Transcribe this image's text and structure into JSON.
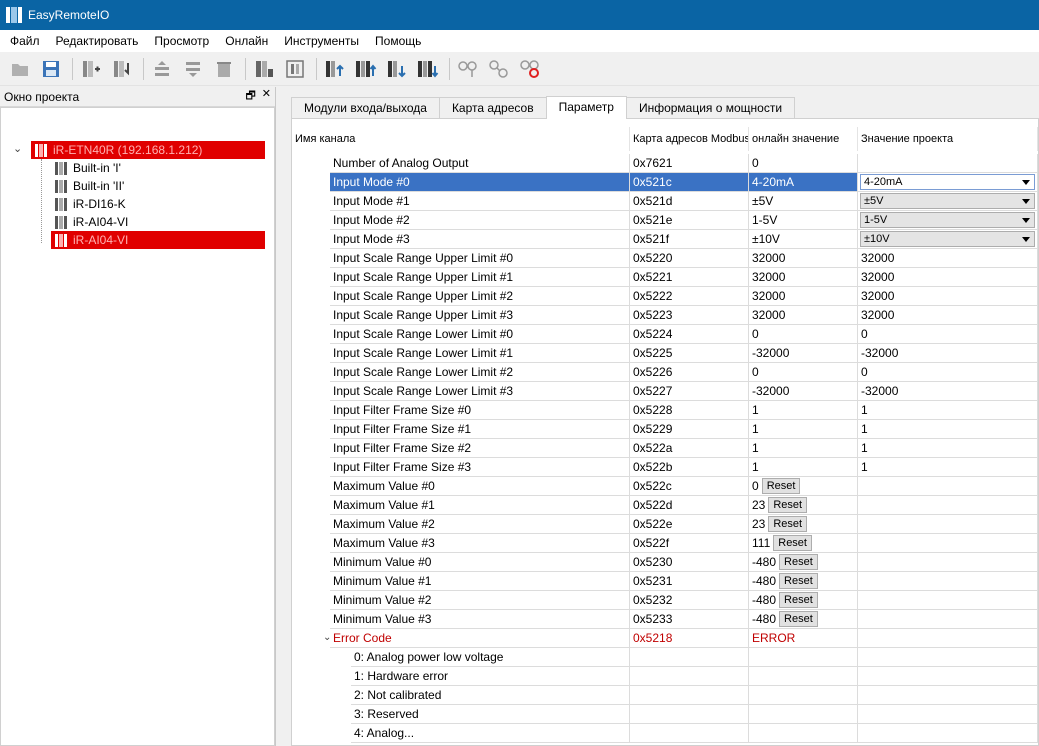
{
  "window": {
    "title": "EasyRemoteIO"
  },
  "menu": [
    "Файл",
    "Редактировать",
    "Просмотр",
    "Онлайн",
    "Инструменты",
    "Помощь"
  ],
  "toolbar": {
    "icons": [
      "open-folder-icon",
      "save-icon",
      "add-module-icon",
      "insert-module-icon",
      "move-up-icon",
      "move-down-icon",
      "delete-icon",
      "module-config-icon",
      "module-io-icon",
      "upload-icon",
      "upload-all-icon",
      "download-icon",
      "download-all-icon",
      "connect-icon",
      "online-icon",
      "disconnect-icon"
    ]
  },
  "project": {
    "header": "Окно проекта",
    "pin": "🗗",
    "close": "✕",
    "root": "iR-ETN40R (192.168.1.212)",
    "nodes": [
      "Built-in 'I'",
      "Built-in 'II'",
      "iR-DI16-K",
      "iR-AI04-VI",
      "iR-AI04-VI"
    ]
  },
  "tabs": [
    "Модули входа/выхода",
    "Карта адресов",
    "Параметр",
    "Информация о мощности"
  ],
  "active_tab": 2,
  "grid": {
    "columns": [
      "Имя канала",
      "Карта адресов Modbus",
      "онлайн значение",
      "Значение проекта"
    ],
    "reset_label": "Reset",
    "rows": [
      {
        "name": "Number of Analog Output",
        "addr": "0x7621",
        "online": "0",
        "project": ""
      },
      {
        "name": "Input Mode #0",
        "addr": "0x521c",
        "online": "4-20mA",
        "project": "4-20mA"
      },
      {
        "name": "Input Mode #1",
        "addr": "0x521d",
        "online": "±5V",
        "project": "±5V"
      },
      {
        "name": "Input Mode #2",
        "addr": "0x521e",
        "online": "1-5V",
        "project": "1-5V"
      },
      {
        "name": "Input Mode #3",
        "addr": "0x521f",
        "online": "±10V",
        "project": "±10V"
      },
      {
        "name": "Input Scale Range Upper Limit #0",
        "addr": "0x5220",
        "online": "32000",
        "project": "32000"
      },
      {
        "name": "Input Scale Range Upper Limit #1",
        "addr": "0x5221",
        "online": "32000",
        "project": "32000"
      },
      {
        "name": "Input Scale Range Upper Limit #2",
        "addr": "0x5222",
        "online": "32000",
        "project": "32000"
      },
      {
        "name": "Input Scale Range Upper Limit #3",
        "addr": "0x5223",
        "online": "32000",
        "project": "32000"
      },
      {
        "name": "Input Scale Range Lower Limit #0",
        "addr": "0x5224",
        "online": "0",
        "project": "0"
      },
      {
        "name": "Input Scale Range Lower Limit #1",
        "addr": "0x5225",
        "online": "-32000",
        "project": "-32000"
      },
      {
        "name": "Input Scale Range Lower Limit #2",
        "addr": "0x5226",
        "online": "0",
        "project": "0"
      },
      {
        "name": "Input Scale Range Lower Limit #3",
        "addr": "0x5227",
        "online": "-32000",
        "project": "-32000"
      },
      {
        "name": "Input Filter Frame Size #0",
        "addr": "0x5228",
        "online": "1",
        "project": "1"
      },
      {
        "name": "Input Filter Frame Size #1",
        "addr": "0x5229",
        "online": "1",
        "project": "1"
      },
      {
        "name": "Input Filter Frame Size #2",
        "addr": "0x522a",
        "online": "1",
        "project": "1"
      },
      {
        "name": "Input Filter Frame Size #3",
        "addr": "0x522b",
        "online": "1",
        "project": "1"
      },
      {
        "name": "Maximum Value #0",
        "addr": "0x522c",
        "online": "0",
        "project": ""
      },
      {
        "name": "Maximum Value #1",
        "addr": "0x522d",
        "online": "23",
        "project": ""
      },
      {
        "name": "Maximum Value #2",
        "addr": "0x522e",
        "online": "23",
        "project": ""
      },
      {
        "name": "Maximum Value #3",
        "addr": "0x522f",
        "online": "111",
        "project": ""
      },
      {
        "name": "Minimum Value #0",
        "addr": "0x5230",
        "online": "-480",
        "project": ""
      },
      {
        "name": "Minimum Value #1",
        "addr": "0x5231",
        "online": "-480",
        "project": ""
      },
      {
        "name": "Minimum Value #2",
        "addr": "0x5232",
        "online": "-480",
        "project": ""
      },
      {
        "name": "Minimum Value #3",
        "addr": "0x5233",
        "online": "-480",
        "project": ""
      },
      {
        "name": "Error Code",
        "addr": "0x5218",
        "online": "ERROR",
        "project": ""
      },
      {
        "name": "0: Analog power low voltage",
        "addr": "",
        "online": "",
        "project": ""
      },
      {
        "name": "1: Hardware error",
        "addr": "",
        "online": "",
        "project": ""
      },
      {
        "name": "2: Not calibrated",
        "addr": "",
        "online": "",
        "project": ""
      },
      {
        "name": "3: Reserved",
        "addr": "",
        "online": "",
        "project": ""
      },
      {
        "name": "4: Analog...",
        "addr": "",
        "online": "",
        "project": ""
      }
    ]
  },
  "colors": {
    "titlebar": "#0a64a4",
    "selection": "#3a72c4",
    "tree_highlight": "#e00000",
    "error_text": "#c00000"
  }
}
